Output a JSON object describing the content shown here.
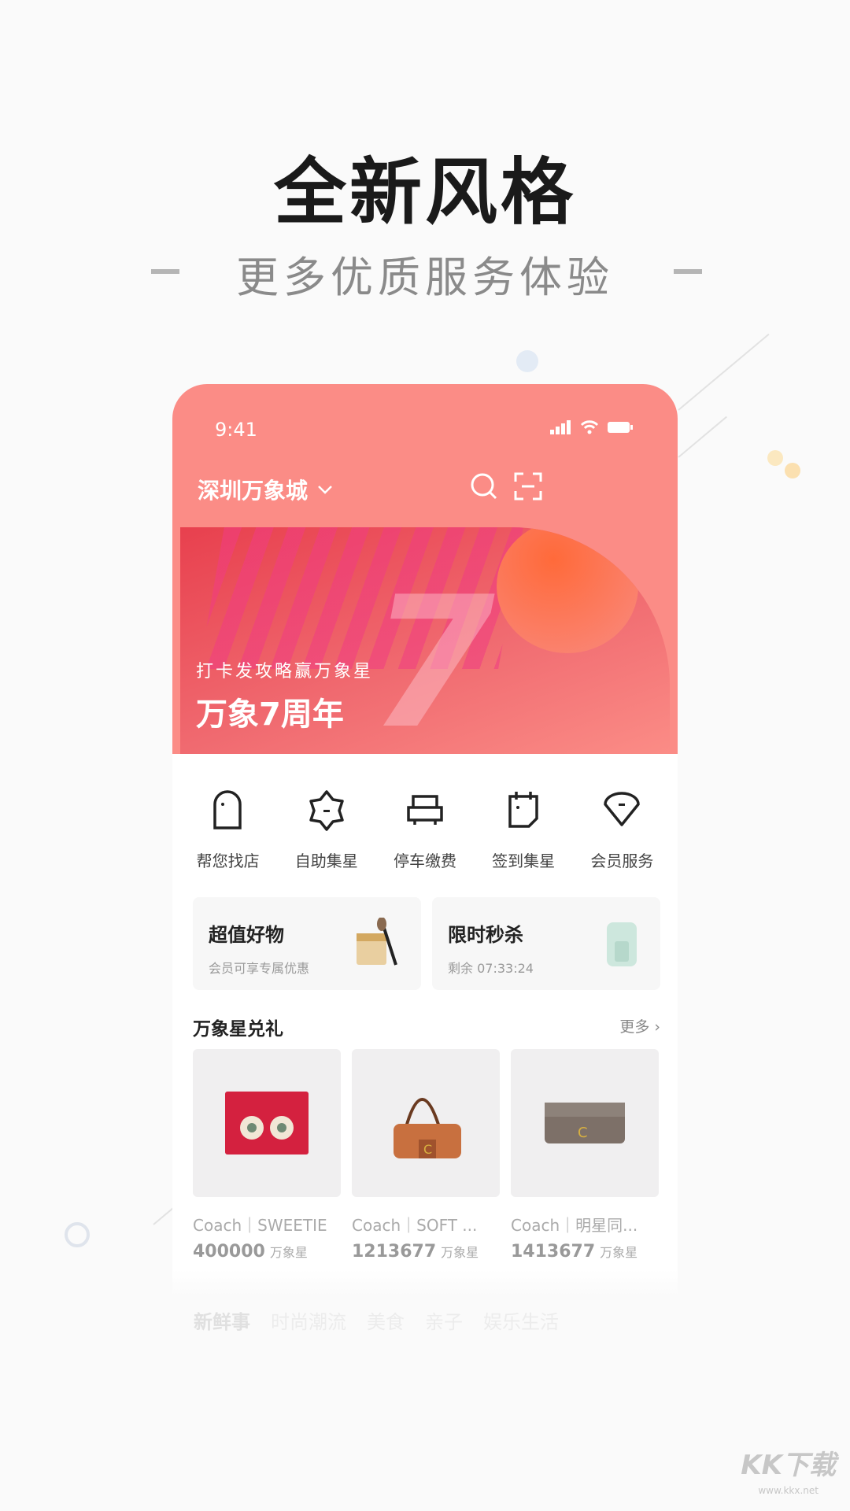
{
  "hero": {
    "title": "全新风格",
    "subtitle": "更多优质服务体验"
  },
  "phone": {
    "status": {
      "time": "9:41"
    },
    "header": {
      "location": "深圳万象城",
      "icons": [
        "search-icon",
        "scan-icon"
      ]
    },
    "banner": {
      "subtitle": "打卡发攻略赢万象星",
      "title": "万象7周年"
    },
    "quick_actions": [
      {
        "label": "帮您找店",
        "icon": "store-icon"
      },
      {
        "label": "自助集星",
        "icon": "star-badge-icon"
      },
      {
        "label": "停车缴费",
        "icon": "car-icon"
      },
      {
        "label": "签到集星",
        "icon": "calendar-icon"
      },
      {
        "label": "会员服务",
        "icon": "gem-icon"
      }
    ],
    "promos": [
      {
        "title": "超值好物",
        "subtitle": "会员可享专属优惠"
      },
      {
        "title": "限时秒杀",
        "subtitle": "剩余  07:33:24"
      }
    ],
    "rewards": {
      "title": "万象星兑礼",
      "more": "更多 ›",
      "items": [
        {
          "name": "Coach｜SWEETIE",
          "price": "400000",
          "unit": "万象星"
        },
        {
          "name": "Coach｜SOFT ...",
          "price": "1213677",
          "unit": "万象星"
        },
        {
          "name": "Coach｜明星同...",
          "price": "1413677",
          "unit": "万象星"
        }
      ]
    },
    "tabs": [
      "新鲜事",
      "时尚潮流",
      "美食",
      "亲子",
      "娱乐生活"
    ]
  },
  "watermark": {
    "logo": "KK下载",
    "url": "www.kkx.net"
  },
  "colors": {
    "accent": "#fb8c86",
    "banner": "#e8404e"
  }
}
